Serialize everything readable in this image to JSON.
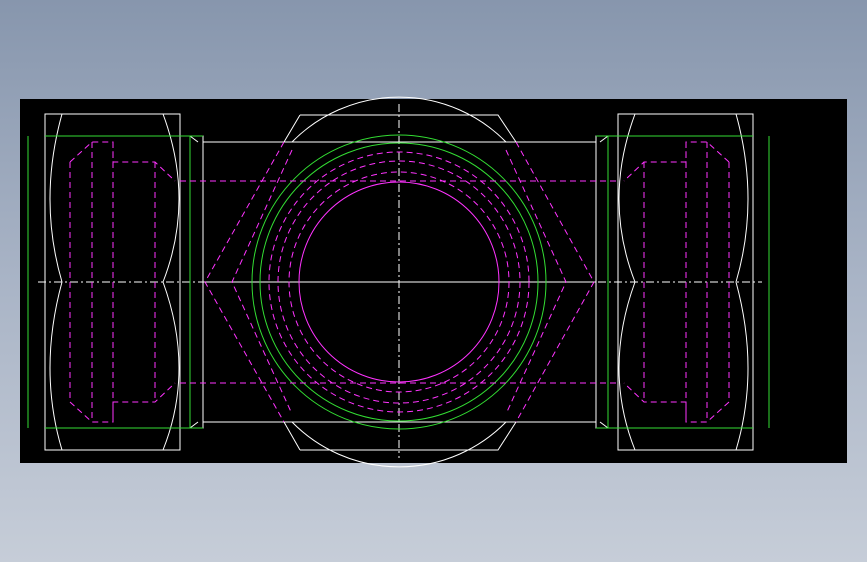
{
  "drawing": {
    "kind": "cad-technical-drawing",
    "subject": "pipe-fitting-cross-section",
    "background_color": "#000000",
    "window_background": [
      "#8796ad",
      "#c6cdd8"
    ],
    "line_colors": {
      "outline": "#ffffff",
      "hidden": "#ff33ff",
      "thread": "#33dd33",
      "hole": "#ff33ff",
      "centerline": "#ffffff"
    },
    "icons": [
      "hex-nut-icon",
      "thread-circle-icon",
      "centerline-icon"
    ]
  }
}
